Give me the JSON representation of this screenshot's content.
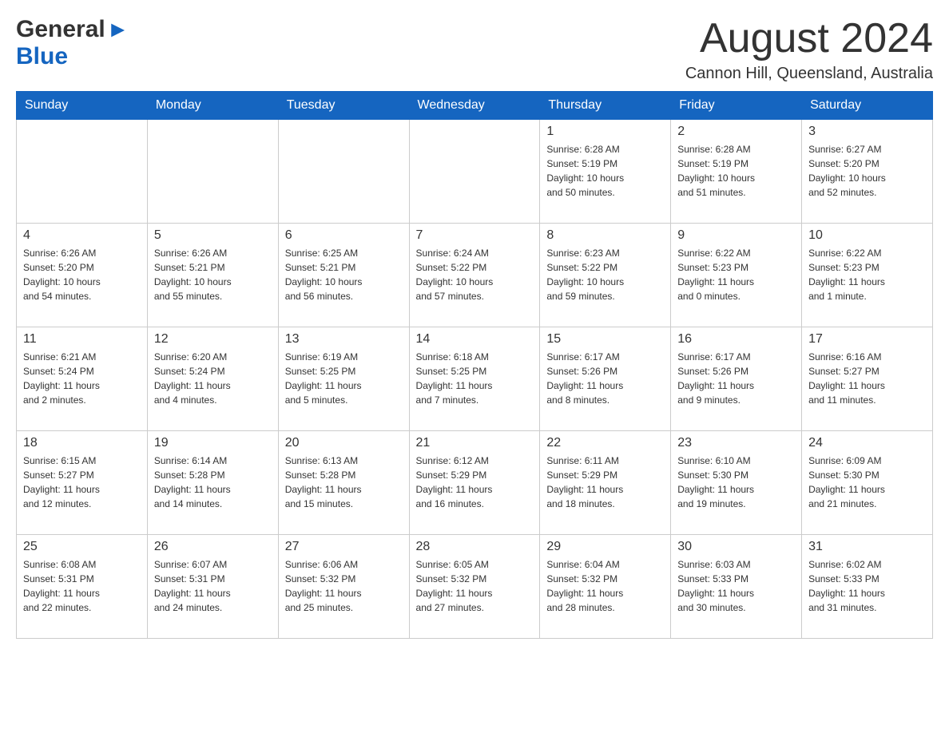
{
  "header": {
    "logo_general": "General",
    "logo_blue": "Blue",
    "month_title": "August 2024",
    "location": "Cannon Hill, Queensland, Australia"
  },
  "days_of_week": [
    "Sunday",
    "Monday",
    "Tuesday",
    "Wednesday",
    "Thursday",
    "Friday",
    "Saturday"
  ],
  "weeks": [
    {
      "days": [
        {
          "number": "",
          "info": ""
        },
        {
          "number": "",
          "info": ""
        },
        {
          "number": "",
          "info": ""
        },
        {
          "number": "",
          "info": ""
        },
        {
          "number": "1",
          "info": "Sunrise: 6:28 AM\nSunset: 5:19 PM\nDaylight: 10 hours\nand 50 minutes."
        },
        {
          "number": "2",
          "info": "Sunrise: 6:28 AM\nSunset: 5:19 PM\nDaylight: 10 hours\nand 51 minutes."
        },
        {
          "number": "3",
          "info": "Sunrise: 6:27 AM\nSunset: 5:20 PM\nDaylight: 10 hours\nand 52 minutes."
        }
      ]
    },
    {
      "days": [
        {
          "number": "4",
          "info": "Sunrise: 6:26 AM\nSunset: 5:20 PM\nDaylight: 10 hours\nand 54 minutes."
        },
        {
          "number": "5",
          "info": "Sunrise: 6:26 AM\nSunset: 5:21 PM\nDaylight: 10 hours\nand 55 minutes."
        },
        {
          "number": "6",
          "info": "Sunrise: 6:25 AM\nSunset: 5:21 PM\nDaylight: 10 hours\nand 56 minutes."
        },
        {
          "number": "7",
          "info": "Sunrise: 6:24 AM\nSunset: 5:22 PM\nDaylight: 10 hours\nand 57 minutes."
        },
        {
          "number": "8",
          "info": "Sunrise: 6:23 AM\nSunset: 5:22 PM\nDaylight: 10 hours\nand 59 minutes."
        },
        {
          "number": "9",
          "info": "Sunrise: 6:22 AM\nSunset: 5:23 PM\nDaylight: 11 hours\nand 0 minutes."
        },
        {
          "number": "10",
          "info": "Sunrise: 6:22 AM\nSunset: 5:23 PM\nDaylight: 11 hours\nand 1 minute."
        }
      ]
    },
    {
      "days": [
        {
          "number": "11",
          "info": "Sunrise: 6:21 AM\nSunset: 5:24 PM\nDaylight: 11 hours\nand 2 minutes."
        },
        {
          "number": "12",
          "info": "Sunrise: 6:20 AM\nSunset: 5:24 PM\nDaylight: 11 hours\nand 4 minutes."
        },
        {
          "number": "13",
          "info": "Sunrise: 6:19 AM\nSunset: 5:25 PM\nDaylight: 11 hours\nand 5 minutes."
        },
        {
          "number": "14",
          "info": "Sunrise: 6:18 AM\nSunset: 5:25 PM\nDaylight: 11 hours\nand 7 minutes."
        },
        {
          "number": "15",
          "info": "Sunrise: 6:17 AM\nSunset: 5:26 PM\nDaylight: 11 hours\nand 8 minutes."
        },
        {
          "number": "16",
          "info": "Sunrise: 6:17 AM\nSunset: 5:26 PM\nDaylight: 11 hours\nand 9 minutes."
        },
        {
          "number": "17",
          "info": "Sunrise: 6:16 AM\nSunset: 5:27 PM\nDaylight: 11 hours\nand 11 minutes."
        }
      ]
    },
    {
      "days": [
        {
          "number": "18",
          "info": "Sunrise: 6:15 AM\nSunset: 5:27 PM\nDaylight: 11 hours\nand 12 minutes."
        },
        {
          "number": "19",
          "info": "Sunrise: 6:14 AM\nSunset: 5:28 PM\nDaylight: 11 hours\nand 14 minutes."
        },
        {
          "number": "20",
          "info": "Sunrise: 6:13 AM\nSunset: 5:28 PM\nDaylight: 11 hours\nand 15 minutes."
        },
        {
          "number": "21",
          "info": "Sunrise: 6:12 AM\nSunset: 5:29 PM\nDaylight: 11 hours\nand 16 minutes."
        },
        {
          "number": "22",
          "info": "Sunrise: 6:11 AM\nSunset: 5:29 PM\nDaylight: 11 hours\nand 18 minutes."
        },
        {
          "number": "23",
          "info": "Sunrise: 6:10 AM\nSunset: 5:30 PM\nDaylight: 11 hours\nand 19 minutes."
        },
        {
          "number": "24",
          "info": "Sunrise: 6:09 AM\nSunset: 5:30 PM\nDaylight: 11 hours\nand 21 minutes."
        }
      ]
    },
    {
      "days": [
        {
          "number": "25",
          "info": "Sunrise: 6:08 AM\nSunset: 5:31 PM\nDaylight: 11 hours\nand 22 minutes."
        },
        {
          "number": "26",
          "info": "Sunrise: 6:07 AM\nSunset: 5:31 PM\nDaylight: 11 hours\nand 24 minutes."
        },
        {
          "number": "27",
          "info": "Sunrise: 6:06 AM\nSunset: 5:32 PM\nDaylight: 11 hours\nand 25 minutes."
        },
        {
          "number": "28",
          "info": "Sunrise: 6:05 AM\nSunset: 5:32 PM\nDaylight: 11 hours\nand 27 minutes."
        },
        {
          "number": "29",
          "info": "Sunrise: 6:04 AM\nSunset: 5:32 PM\nDaylight: 11 hours\nand 28 minutes."
        },
        {
          "number": "30",
          "info": "Sunrise: 6:03 AM\nSunset: 5:33 PM\nDaylight: 11 hours\nand 30 minutes."
        },
        {
          "number": "31",
          "info": "Sunrise: 6:02 AM\nSunset: 5:33 PM\nDaylight: 11 hours\nand 31 minutes."
        }
      ]
    }
  ]
}
